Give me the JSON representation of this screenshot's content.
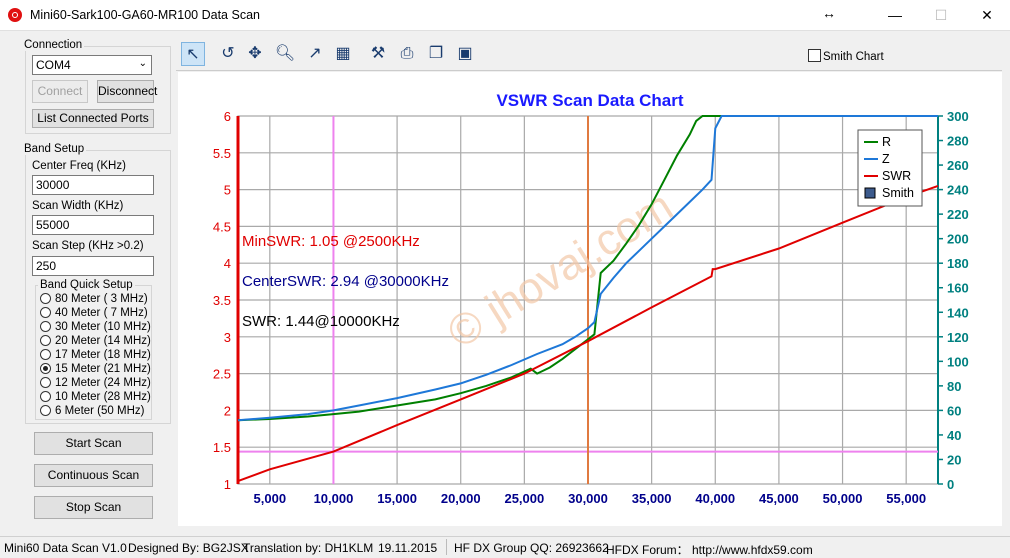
{
  "window": {
    "title": "Mini60-Sark100-GA60-MR100 Data Scan"
  },
  "connection": {
    "group_label": "Connection",
    "port_value": "COM4",
    "connect_label": "Connect",
    "disconnect_label": "Disconnect",
    "list_ports_label": "List Connected Ports"
  },
  "band_setup": {
    "group_label": "Band Setup",
    "center_freq_label": "Center Freq  (KHz)",
    "center_freq_value": "30000",
    "scan_width_label": "Scan Width   (KHz)",
    "scan_width_value": "55000",
    "scan_step_label": "Scan Step     (KHz >0.2)",
    "scan_step_value": "250",
    "quick_label": "Band Quick Setup",
    "bands": [
      {
        "label": "80 Meter (  3 MHz)",
        "checked": false
      },
      {
        "label": "40 Meter (  7 MHz)",
        "checked": false
      },
      {
        "label": "30 Meter (10 MHz)",
        "checked": false
      },
      {
        "label": "20 Meter (14 MHz)",
        "checked": false
      },
      {
        "label": "17 Meter (18 MHz)",
        "checked": false
      },
      {
        "label": "15 Meter (21 MHz)",
        "checked": true
      },
      {
        "label": "12 Meter (24 MHz)",
        "checked": false
      },
      {
        "label": "10 Meter (28 MHz)",
        "checked": false
      },
      {
        "label": "6 Meter  (50 MHz)",
        "checked": false
      }
    ]
  },
  "actions": {
    "start_label": "Start Scan",
    "continuous_label": "Continuous Scan",
    "stop_label": "Stop Scan"
  },
  "toolbar": {
    "icons": [
      "pointer-icon",
      "undo-icon",
      "pan-icon",
      "zoom-icon",
      "export-icon",
      "table-icon",
      "settings-icon",
      "print-icon",
      "copy-icon",
      "save-icon"
    ],
    "smith_chart_label": "Smith Chart"
  },
  "chart_data": {
    "type": "line",
    "title": "VSWR Scan Data Chart",
    "xlim": [
      2500,
      57500
    ],
    "x_ticks": [
      "5,000",
      "10,000",
      "15,000",
      "20,000",
      "25,000",
      "30,000",
      "35,000",
      "40,000",
      "45,000",
      "50,000",
      "55,000"
    ],
    "x_tick_values": [
      5000,
      10000,
      15000,
      20000,
      25000,
      30000,
      35000,
      40000,
      45000,
      50000,
      55000
    ],
    "left_axis": {
      "ylim": [
        1,
        6
      ],
      "ticks": [
        "1",
        "1.5",
        "2",
        "2.5",
        "3",
        "3.5",
        "4",
        "4.5",
        "5",
        "5.5",
        "6"
      ],
      "color": "#e00000"
    },
    "right_axis": {
      "ylim": [
        0,
        300
      ],
      "ticks": [
        "0",
        "20",
        "40",
        "60",
        "80",
        "100",
        "120",
        "140",
        "160",
        "180",
        "200",
        "220",
        "240",
        "260",
        "280",
        "300"
      ],
      "color": "#008080"
    },
    "grid": true,
    "legend_position": "top-right",
    "series": [
      {
        "name": "R",
        "color": "#008000",
        "axis": "right",
        "x": [
          2500,
          5000,
          8000,
          10000,
          12000,
          15000,
          18000,
          20000,
          22000,
          24000,
          25500,
          26000,
          27000,
          28000,
          29000,
          30000,
          30500,
          31000,
          32000,
          33000,
          34000,
          35000,
          36000,
          37000,
          38000,
          38500,
          39000,
          40000,
          57500
        ],
        "y": [
          52,
          53,
          55,
          57,
          59,
          64,
          69,
          74,
          80,
          87,
          94,
          90,
          95,
          102,
          110,
          118,
          122,
          172,
          182,
          196,
          211,
          228,
          248,
          268,
          285,
          296,
          300,
          300,
          300
        ]
      },
      {
        "name": "Z",
        "color": "#1e78d8",
        "axis": "right",
        "x": [
          2500,
          5000,
          8000,
          10000,
          12000,
          15000,
          18000,
          20000,
          22000,
          24000,
          26000,
          28000,
          29000,
          30000,
          30500,
          31000,
          32000,
          33000,
          35000,
          36000,
          37000,
          38000,
          39000,
          39700,
          40000,
          40500,
          57500
        ],
        "y": [
          52,
          54,
          57,
          60,
          64,
          70,
          77,
          82,
          89,
          97,
          106,
          114,
          120,
          127,
          132,
          155,
          168,
          180,
          200,
          210,
          220,
          230,
          240,
          248,
          290,
          300,
          300
        ]
      },
      {
        "name": "SWR",
        "color": "#e00000",
        "axis": "left",
        "x": [
          2500,
          5000,
          10000,
          15000,
          20000,
          25000,
          30000,
          35000,
          39700,
          39800,
          40000,
          45000,
          50000,
          55000,
          57500
        ],
        "y": [
          1.04,
          1.2,
          1.44,
          1.8,
          2.15,
          2.5,
          2.94,
          3.4,
          3.82,
          3.92,
          3.92,
          4.2,
          4.55,
          4.9,
          5.05
        ]
      }
    ],
    "legend_extra": {
      "name": "Smith",
      "color": "#3c5a8c"
    },
    "annotations": [
      {
        "text": "MinSWR: 1.05 @2500KHz",
        "color": "#e00000"
      },
      {
        "text": "CenterSWR: 2.94 @30000KHz",
        "color": "#00008b"
      },
      {
        "text": "SWR: 1.44@10000KHz",
        "color": "#000000"
      }
    ],
    "markers": [
      {
        "type": "vertical",
        "x": 10000,
        "color": "#ee82ee"
      },
      {
        "type": "horizontal",
        "y": 1.44,
        "color": "#ee82ee"
      },
      {
        "type": "vertical",
        "x": 30000,
        "color": "#e07a40"
      },
      {
        "type": "vertical",
        "x": 2500,
        "color": "#e00000"
      }
    ],
    "watermark": "© jhovaj.com"
  },
  "status": {
    "version": "Mini60 Data Scan V1.0",
    "designed": "Designed By: BG2JSX",
    "translation": "Translation by: DH1KLM",
    "date": "19.11.2015",
    "group": "HF DX Group QQ: 26923662",
    "forum": "HFDX Forum：  http://www.hfdx59.com"
  }
}
